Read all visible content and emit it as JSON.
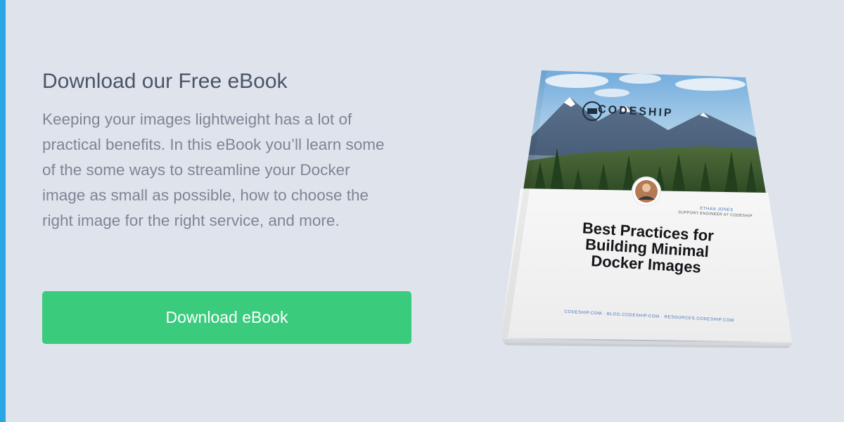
{
  "promo": {
    "title": "Download our Free eBook",
    "description": "Keeping your images lightweight has a lot of practical benefits. In this eBook you’ll learn some of the some ways to streamline your Docker image as small as possible, how to choose the right image for the right service, and more.",
    "button_label": "Download eBook"
  },
  "book": {
    "brand": "CODESHIP",
    "author_name": "ETHAN JONES",
    "author_role": "SUPPORT ENGINEER AT CODESHIP",
    "title": "Best Practices for Building Minimal Docker Images",
    "footer": "CODESHIP.COM · BLOG.CODESHIP.COM · RESOURCES.CODESHIP.COM"
  },
  "colors": {
    "background": "#dfe4ec",
    "accent_bar": "#2ba6e4",
    "button": "#3acb7d",
    "title_text": "#4a5568",
    "body_text": "#7d8595"
  }
}
